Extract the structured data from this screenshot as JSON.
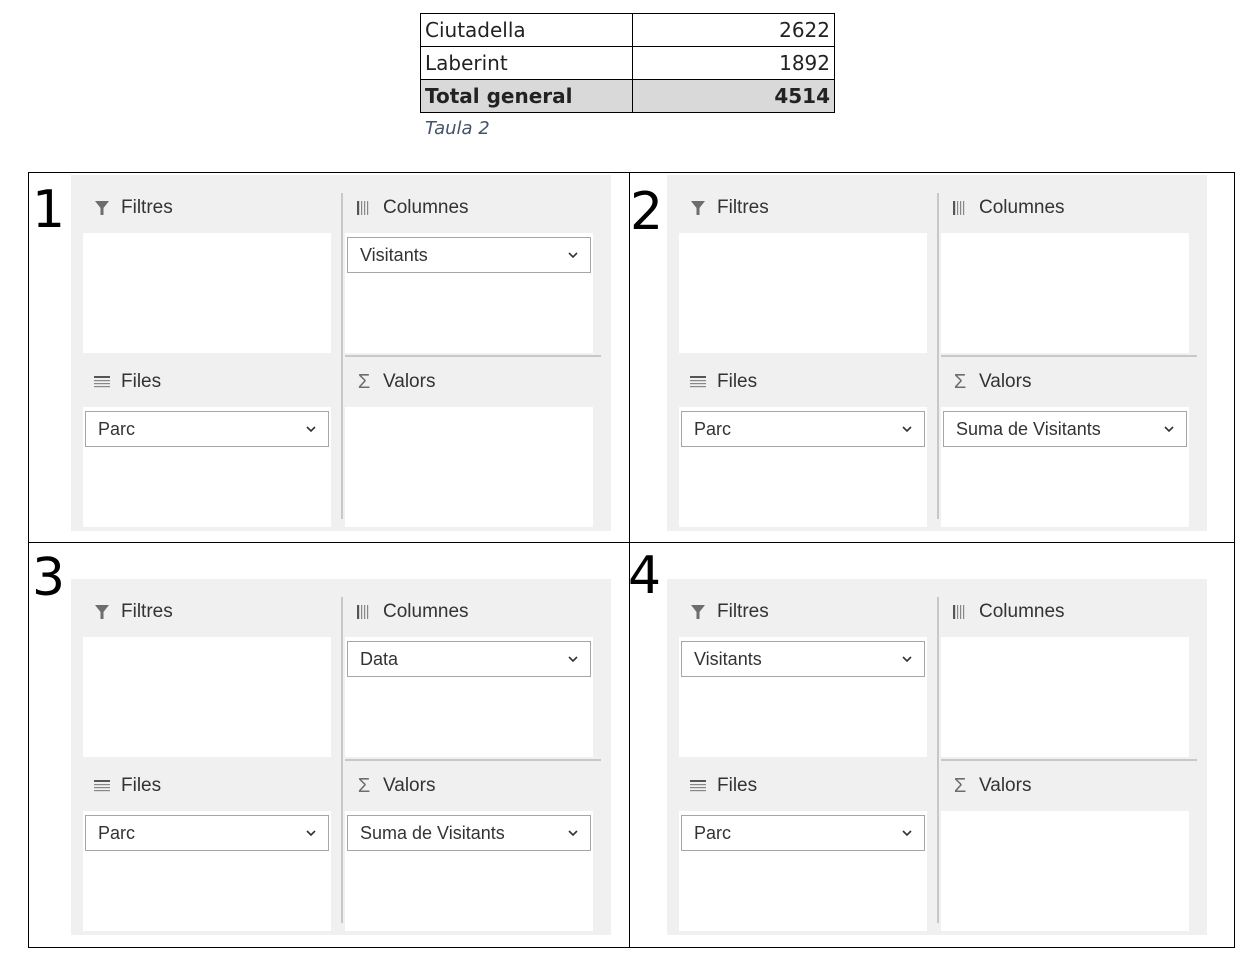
{
  "summary_table": {
    "rows": [
      {
        "name": "Ciutadella",
        "value": "2622"
      },
      {
        "name": "Laberint",
        "value": "1892"
      }
    ],
    "total": {
      "name": "Total general",
      "value": "4514"
    },
    "caption": "Taula 2"
  },
  "zone_labels": {
    "filters": "Filtres",
    "columns": "Columnes",
    "rows": "Files",
    "values": "Valors"
  },
  "options": [
    {
      "number": "1",
      "filters": "",
      "columns": "Visitants",
      "rows": "Parc",
      "values": ""
    },
    {
      "number": "2",
      "filters": "",
      "columns": "",
      "rows": "Parc",
      "values": "Suma de Visitants"
    },
    {
      "number": "3",
      "filters": "",
      "columns": "Data",
      "rows": "Parc",
      "values": "Suma de Visitants"
    },
    {
      "number": "4",
      "filters": "Visitants",
      "columns": "",
      "rows": "Parc",
      "values": ""
    }
  ],
  "icons": {
    "filters": "funnel-icon",
    "columns": "columns-icon",
    "rows": "rows-icon",
    "values": "sigma-icon",
    "dropdown": "chevron-down-icon"
  }
}
